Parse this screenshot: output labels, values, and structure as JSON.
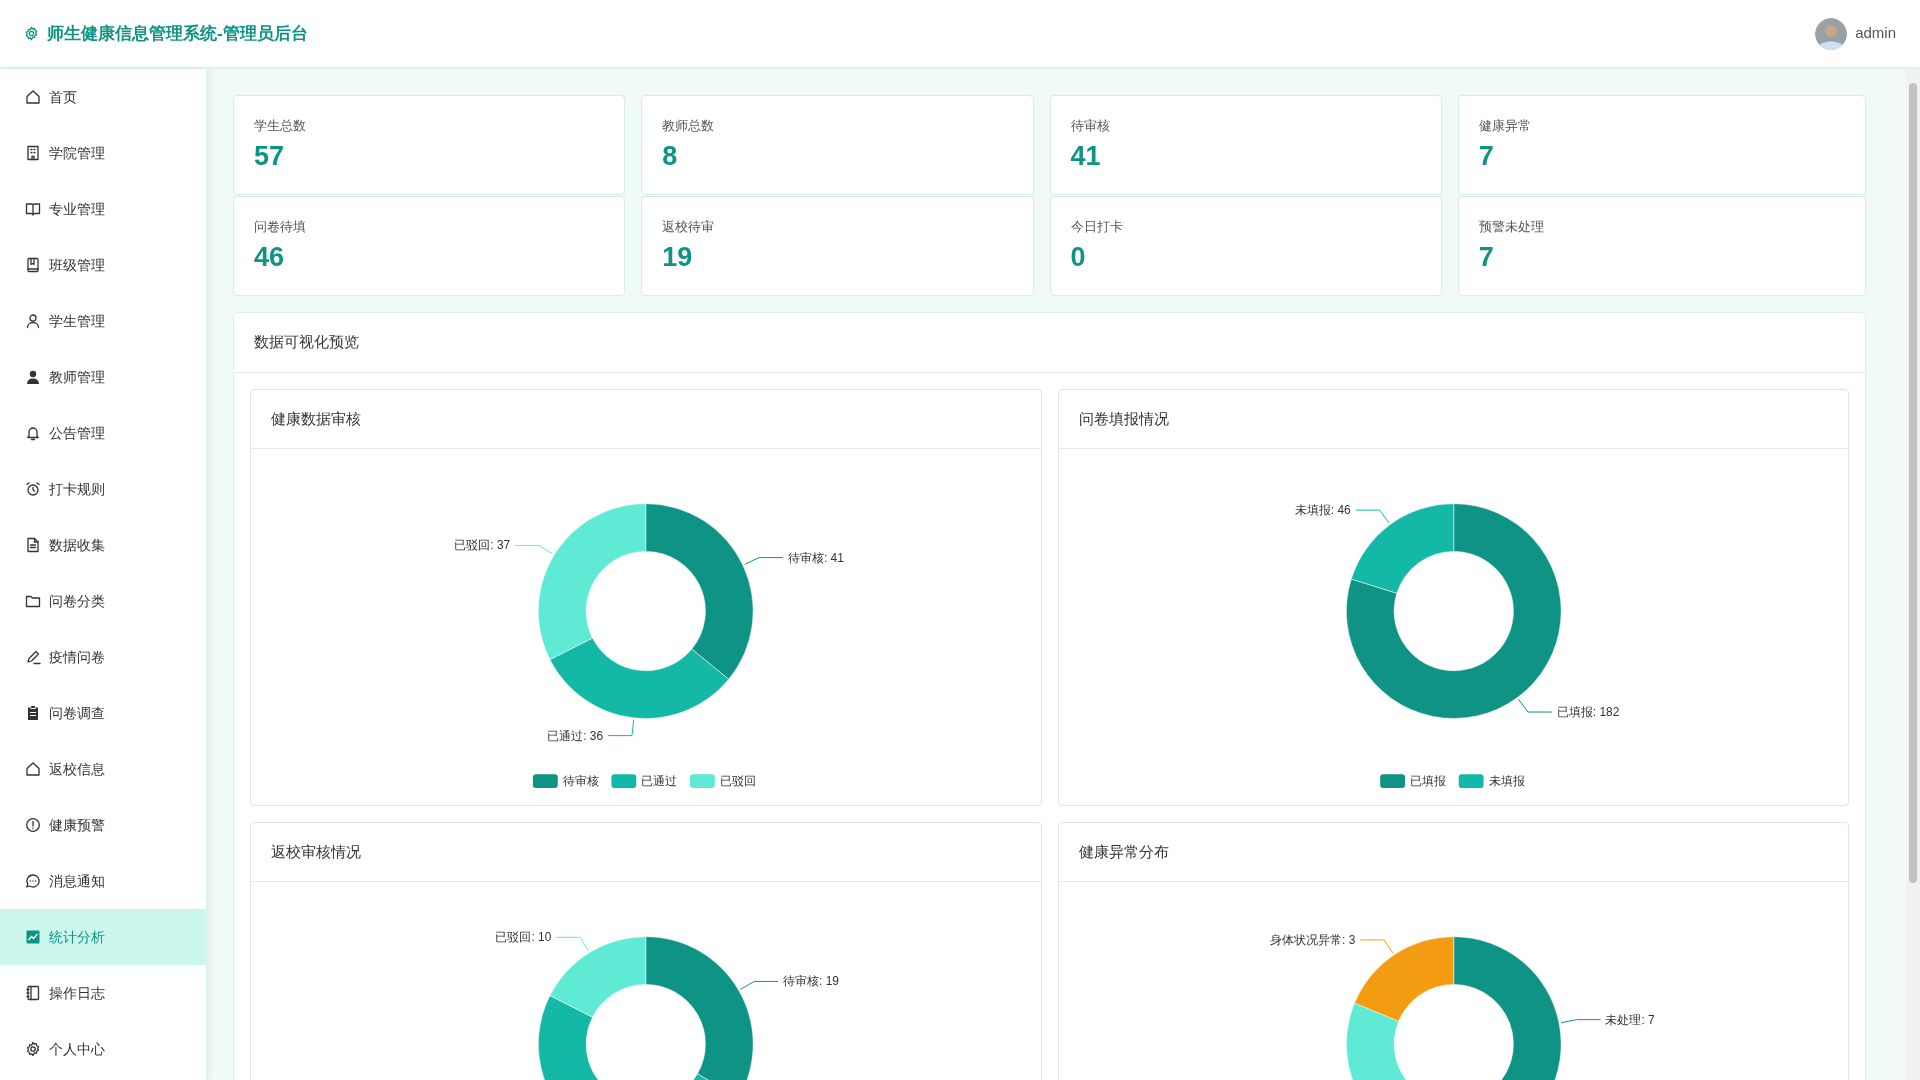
{
  "header": {
    "title": "师生健康信息管理系统-管理员后台",
    "user": "admin"
  },
  "sidebar": {
    "items": [
      {
        "label": "首页",
        "selected": false
      },
      {
        "label": "学院管理",
        "selected": false
      },
      {
        "label": "专业管理",
        "selected": false
      },
      {
        "label": "班级管理",
        "selected": false
      },
      {
        "label": "学生管理",
        "selected": false
      },
      {
        "label": "教师管理",
        "selected": false
      },
      {
        "label": "公告管理",
        "selected": false
      },
      {
        "label": "打卡规则",
        "selected": false
      },
      {
        "label": "数据收集",
        "selected": false
      },
      {
        "label": "问卷分类",
        "selected": false
      },
      {
        "label": "疫情问卷",
        "selected": false
      },
      {
        "label": "问卷调查",
        "selected": false
      },
      {
        "label": "返校信息",
        "selected": false
      },
      {
        "label": "健康预警",
        "selected": false
      },
      {
        "label": "消息通知",
        "selected": false
      },
      {
        "label": "统计分析",
        "selected": true
      },
      {
        "label": "操作日志",
        "selected": false
      },
      {
        "label": "个人中心",
        "selected": false
      }
    ]
  },
  "stats": [
    {
      "label": "学生总数",
      "value": "57"
    },
    {
      "label": "教师总数",
      "value": "8"
    },
    {
      "label": "待审核",
      "value": "41"
    },
    {
      "label": "健康异常",
      "value": "7"
    },
    {
      "label": "问卷待填",
      "value": "46"
    },
    {
      "label": "返校待审",
      "value": "19"
    },
    {
      "label": "今日打卡",
      "value": "0"
    },
    {
      "label": "预警未处理",
      "value": "7"
    }
  ],
  "visualization": {
    "title": "数据可视化预览",
    "charts": [
      {
        "title": "健康数据审核",
        "chart_data": {
          "type": "donut",
          "legend": "bottom",
          "categories": [
            "待审核",
            "已通过",
            "已驳回"
          ],
          "values": [
            41,
            36,
            37
          ],
          "colors": [
            "#0e9384",
            "#14b8a6",
            "#5eead4"
          ],
          "value_labels": [
            "待审核: 41",
            "已通过: 36",
            "已驳回: 37"
          ]
        }
      },
      {
        "title": "问卷填报情况",
        "chart_data": {
          "type": "donut",
          "legend": "bottom",
          "categories": [
            "已填报",
            "未填报"
          ],
          "values": [
            182,
            46
          ],
          "colors": [
            "#0e9384",
            "#14b8a6"
          ],
          "value_labels": [
            "已填报: 182",
            "未填报: 46"
          ]
        }
      },
      {
        "title": "返校审核情况",
        "chart_data": {
          "type": "donut",
          "values": [
            19,
            28,
            10
          ],
          "colors": [
            "#0e9384",
            "#14b8a6",
            "#5eead4"
          ],
          "value_labels": [
            "待审核: 19",
            null,
            "已驳回: 10"
          ]
        }
      },
      {
        "title": "健康异常分布",
        "chart_data": {
          "type": "donut",
          "values": [
            7,
            6,
            3
          ],
          "colors": [
            "#0e9384",
            "#5eead4",
            "#f39c12"
          ],
          "value_labels": [
            "未处理: 7",
            null,
            "身体状况异常: 3"
          ]
        }
      }
    ]
  }
}
